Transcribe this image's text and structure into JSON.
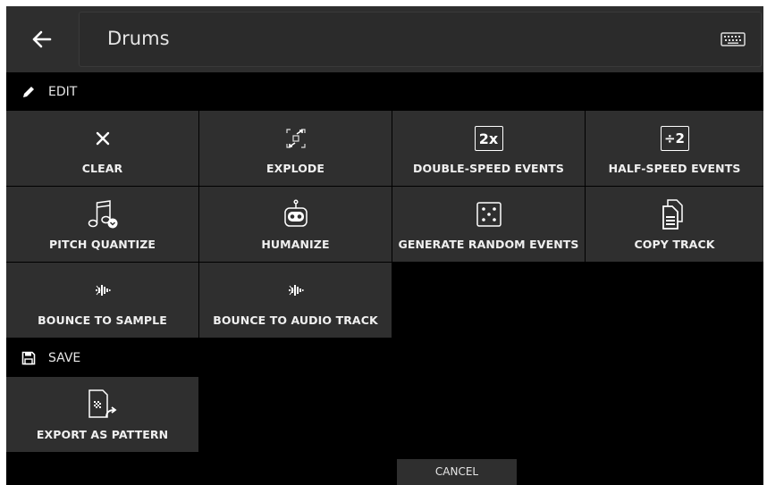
{
  "header": {
    "back_label": "back",
    "title": "Drums",
    "keyboard_icon": "keyboard-icon"
  },
  "edit_section": {
    "label": "EDIT",
    "icon": "pencil-icon"
  },
  "save_section": {
    "label": "SAVE",
    "icon": "floppy-disk-icon"
  },
  "tiles": {
    "clear": "CLEAR",
    "explode": "EXPLODE",
    "double_speed": "DOUBLE-SPEED EVENTS",
    "double_speed_icon_text": "2x",
    "half_speed": "HALF-SPEED EVENTS",
    "half_speed_icon_text": "÷2",
    "pitch_quantize": "PITCH QUANTIZE",
    "humanize": "HUMANIZE",
    "generate_random": "GENERATE RANDOM EVENTS",
    "copy_track": "COPY TRACK",
    "bounce_sample": "BOUNCE TO SAMPLE",
    "bounce_audio": "BOUNCE TO AUDIO TRACK",
    "export_pattern": "EXPORT AS PATTERN"
  },
  "footer": {
    "cancel_label": "CANCEL"
  },
  "colors": {
    "background": "#000000",
    "tile": "#2f2f2f",
    "text": "#f0f0f0",
    "header": "#2e2e2e"
  }
}
